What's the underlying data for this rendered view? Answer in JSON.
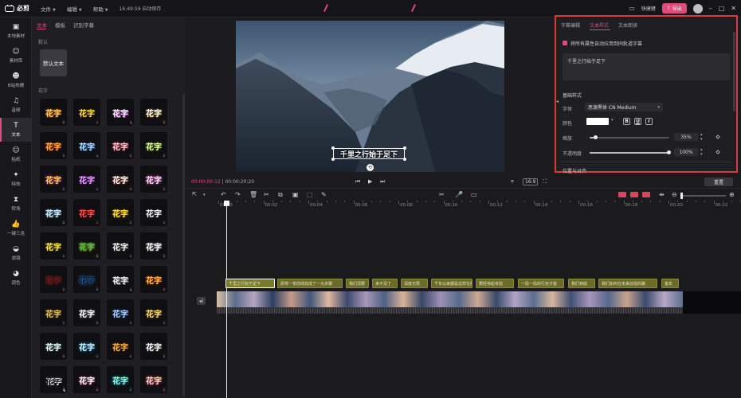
{
  "app": {
    "logo": "必剪",
    "menus": [
      "文件",
      "编辑",
      "帮助"
    ],
    "time": "16:49:59 自动保存",
    "shortcut": "快捷键",
    "export": "导出"
  },
  "nav": [
    {
      "label": "本地素材",
      "icon": "video-icon"
    },
    {
      "label": "素材库",
      "icon": "library-icon"
    },
    {
      "label": "B站热梗",
      "icon": "bilibili-icon"
    },
    {
      "label": "音频",
      "icon": "music-icon"
    },
    {
      "label": "文本",
      "icon": "text-icon"
    },
    {
      "label": "贴纸",
      "icon": "sticker-icon"
    },
    {
      "label": "特效",
      "icon": "effect-icon"
    },
    {
      "label": "转场",
      "icon": "transition-icon"
    },
    {
      "label": "一键三连",
      "icon": "like-icon"
    },
    {
      "label": "滤镜",
      "icon": "filter-icon"
    },
    {
      "label": "调色",
      "icon": "palette-icon"
    }
  ],
  "library": {
    "tabs": [
      "文本",
      "模板",
      "识别字幕"
    ],
    "section_default": "默认",
    "default_label": "默认文本",
    "section_huazi": "花字",
    "huazi_label": "花字"
  },
  "preview": {
    "subtitle": "千里之行始于足下",
    "time_current": "00:00:00:12",
    "time_total": "00:00:20:20",
    "ratio": "16:9"
  },
  "panel": {
    "tabs": [
      "字幕编辑",
      "文本样式",
      "文本朗读"
    ],
    "apply_all": "将所有属性自动应用到同轨道字幕",
    "text_value": "千里之行始于足下",
    "basic_style": "基础样式",
    "font_label": "字体",
    "font_value": "思源黑体 CN Medium",
    "color_label": "颜色",
    "format": [
      "B",
      "U",
      "I"
    ],
    "scale_label": "缩放",
    "scale_value": "35%",
    "scale_fill": 0.07,
    "opacity_label": "不透明度",
    "opacity_value": "100%",
    "opacity_fill": 1.0,
    "pos_label": "位置与对齐",
    "reset": "重置"
  },
  "timeline": {
    "ticks": [
      "00:00",
      "00:02",
      "00:04",
      "00:06",
      "00:08",
      "00:10",
      "00:12",
      "00:14",
      "00:16",
      "00:18",
      "00:20",
      "00:22"
    ],
    "subtitles": [
      "千里之行始于足下",
      "即将一举前线完成了一大步骤",
      "我们须要",
      "来不及了",
      "深度无限",
      "千年以来都是这样在那里",
      "要经得起考验",
      "一段一段的行走才能",
      "我们到底",
      "我们如何在未来创造的路",
      "金年"
    ]
  }
}
